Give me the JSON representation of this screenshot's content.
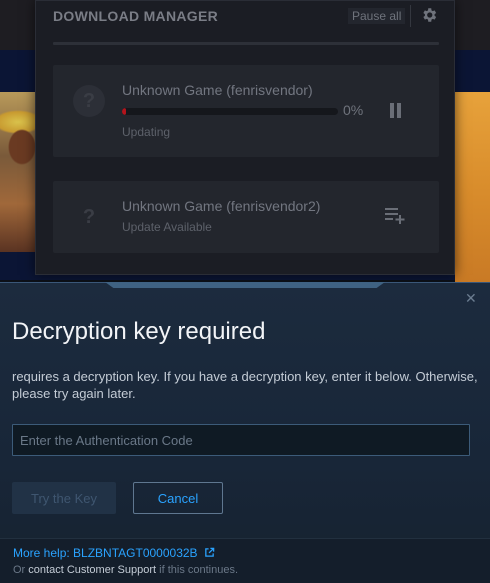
{
  "download_manager": {
    "title": "DOWNLOAD MANAGER",
    "pause_all_label": "Pause all",
    "settings_icon": "gear-icon",
    "items": [
      {
        "name": "Unknown Game (fenrisvendor)",
        "status": "Updating",
        "progress_percent_label": "0%",
        "progress_fraction": 0.02,
        "progress_color": "#b3141c",
        "icon": "question-game-icon",
        "action_icon": "pause-icon"
      },
      {
        "name": "Unknown Game (fenrisvendor2)",
        "status": "Update Available",
        "icon": "question-game-icon",
        "action_icon": "add-to-queue-icon"
      }
    ]
  },
  "dialog": {
    "title": "Decryption key required",
    "body": "requires a decryption key. If you have a decryption key, enter it below. Otherwise, please try again later.",
    "input": {
      "value": "",
      "placeholder": "Enter the Authentication Code"
    },
    "primary_button_label": "Try the Key",
    "secondary_button_label": "Cancel",
    "close_icon": "close-icon",
    "footer": {
      "help_label": "More help:",
      "help_code": "BLZBNTAGT0000032B",
      "support_prefix": "Or",
      "support_link": "contact Customer Support",
      "support_suffix": "if this continues."
    }
  },
  "colors": {
    "accent_blue": "#2aa3ff",
    "dialog_bg": "#1c2b3e",
    "panel_bg": "#1b1d24"
  }
}
